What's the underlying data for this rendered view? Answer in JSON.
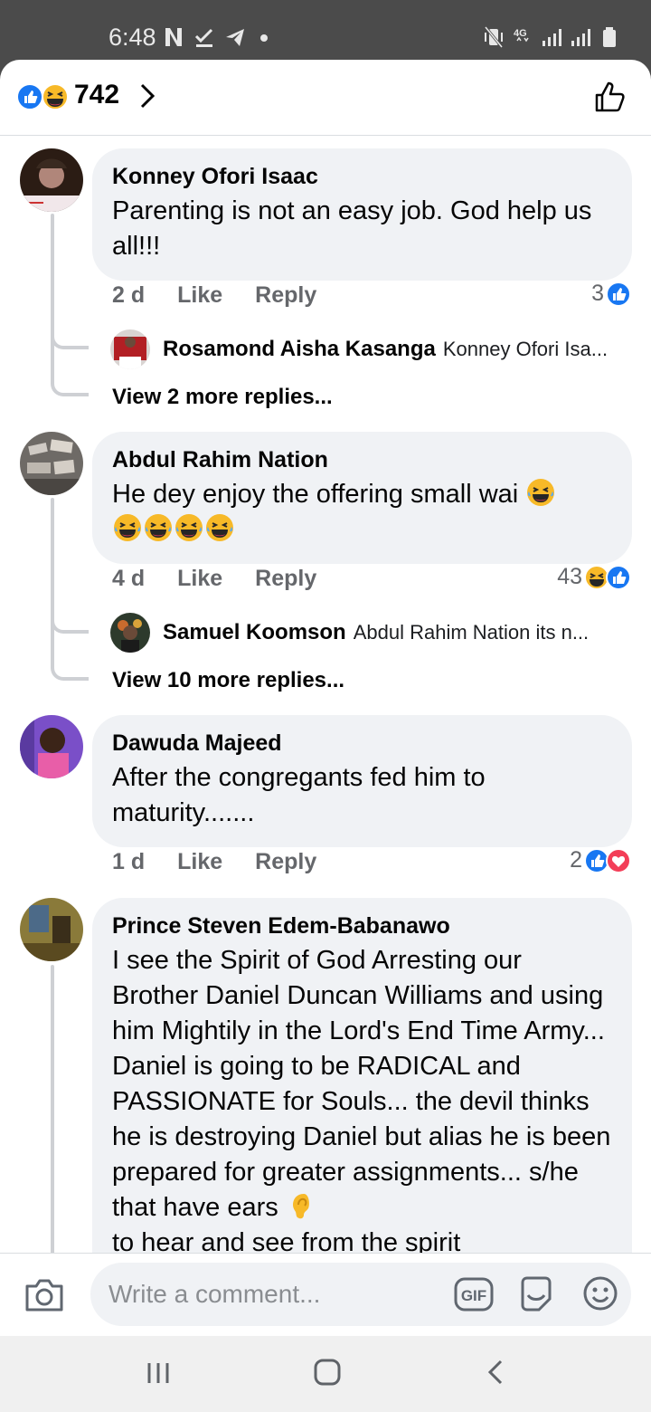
{
  "status_bar": {
    "time": "6:48",
    "left_icons": [
      "netflix-n-icon",
      "download-done-icon",
      "telegram-icon",
      "dot-icon"
    ],
    "right_icons": [
      "vibrate-mute-icon",
      "4g-icon",
      "signal-icon",
      "signal-icon",
      "battery-icon"
    ],
    "network_label": "4G"
  },
  "reactions_header": {
    "count": "742",
    "icons": [
      "like-icon",
      "haha-icon"
    ]
  },
  "comments": [
    {
      "author": "Konney Ofori Isaac",
      "text": "Parenting is not an easy job. God help us all!!!",
      "time": "2 d",
      "like_label": "Like",
      "reply_label": "Reply",
      "reaction_count": "3",
      "reaction_icons": [
        "like-icon"
      ],
      "reply_preview": {
        "author": "Rosamond Aisha Kasanga",
        "text": "Konney Ofori Isa..."
      },
      "view_more": "View 2 more replies..."
    },
    {
      "author": "Abdul Rahim Nation",
      "text": "He dey enjoy the offering small wai",
      "time": "4 d",
      "like_label": "Like",
      "reply_label": "Reply",
      "reaction_count": "43",
      "reaction_icons": [
        "haha-icon",
        "like-icon"
      ],
      "reply_preview": {
        "author": "Samuel Koomson",
        "text": "Abdul Rahim Nation its n..."
      },
      "view_more": "View 10 more replies..."
    },
    {
      "author": "Dawuda Majeed",
      "text": "After the congregants fed him to maturity.......",
      "time": "1 d",
      "like_label": "Like",
      "reply_label": "Reply",
      "reaction_count": "2",
      "reaction_icons": [
        "like-icon",
        "love-icon"
      ]
    },
    {
      "author": "Prince Steven Edem-Babanawo",
      "text": "I see the Spirit of God Arresting our Brother Daniel Duncan Williams and using him Mightily in the Lord's End Time Army... Daniel is going to be RADICAL and PASSIONATE for Souls... the devil thinks he is destroying Daniel but alias he is been prepared for greater assignments... s/he that have ears",
      "text_after_emoji": "to hear and see from the spirit"
    }
  ],
  "composer": {
    "placeholder": "Write a comment...",
    "gif_label": "GIF"
  },
  "colors": {
    "facebook_blue": "#1877f2",
    "love_red": "#f33e58",
    "haha_yellow": "#f7b928",
    "bubble_gray": "#f0f2f5",
    "status_bar": "#4b4b4b"
  }
}
